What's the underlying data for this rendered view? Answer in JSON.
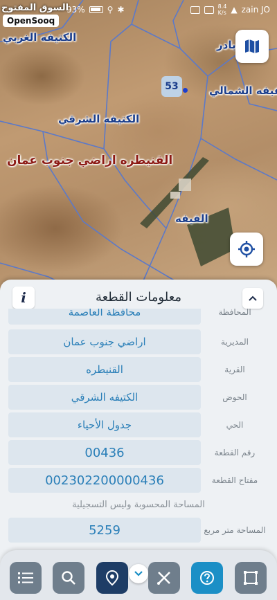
{
  "status_bar": {
    "battery": "93%",
    "network_speed": "8.4\nK/s",
    "carrier": "zain JO"
  },
  "brand": {
    "arabic": "السوق المفتوح",
    "latin": "OpenSooq"
  },
  "map": {
    "labels": {
      "west": "الكتيفه الغربي",
      "north_east": "اللفيفه الشمالي",
      "east": "الكتيفه الشرقي",
      "main": "القنيطره  اراضي جنوب عمان",
      "south": "الفيفه",
      "nav_label": "بادر"
    },
    "parcel_tag": "53",
    "icons": {
      "layers": "map-icon",
      "locate": "crosshair-icon"
    },
    "colors": {
      "boundary": "#5b79c9",
      "label": "#1b3e8c",
      "main_label": "#8c1a14"
    }
  },
  "panel": {
    "title": "معلومات القطعة",
    "info": "i",
    "rows": [
      {
        "key": "المحافظة",
        "value": "محافظة العاصمة"
      },
      {
        "key": "المديرية",
        "value": "اراضي جنوب عمان"
      },
      {
        "key": "القرية",
        "value": "القنيطره"
      },
      {
        "key": "الحوض",
        "value": "الكتيفه الشرقي"
      },
      {
        "key": "الحي",
        "value": "جدول الأحياء"
      },
      {
        "key": "رقم القطعة",
        "value": "00436"
      },
      {
        "key": "مفتاح القطعة",
        "value": "00230220000043‌6"
      }
    ],
    "note": "المساحة المحسوبة وليس التسجيلية",
    "area": {
      "key": "المساحة متر مربع",
      "value": "5259"
    }
  },
  "toolbar": {
    "buttons": [
      {
        "name": "list-button",
        "icon": "list-icon"
      },
      {
        "name": "search-button",
        "icon": "search-icon"
      },
      {
        "name": "location-button",
        "icon": "pin-icon"
      },
      {
        "name": "measure-button",
        "icon": "ruler-icon"
      },
      {
        "name": "help-button",
        "icon": "help-icon"
      },
      {
        "name": "polygon-button",
        "icon": "polygon-icon"
      }
    ],
    "accent": "#1b8fc6"
  }
}
